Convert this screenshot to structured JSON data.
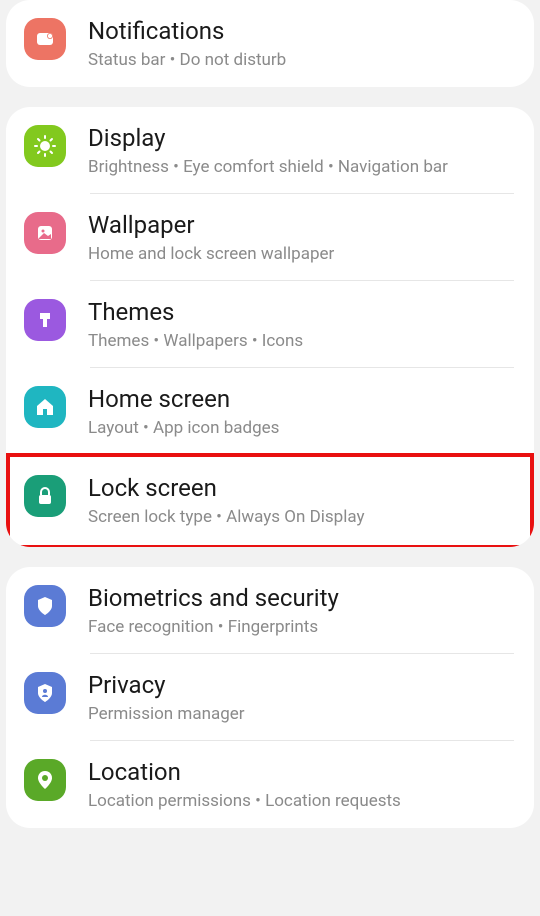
{
  "groups": [
    {
      "items": [
        {
          "id": "notifications",
          "title": "Notifications",
          "subtitle": "Status bar  •  Do not disturb",
          "color": "#ed7464",
          "icon": "bell",
          "highlight": false
        }
      ]
    },
    {
      "items": [
        {
          "id": "display",
          "title": "Display",
          "subtitle": "Brightness  •  Eye comfort shield  •  Navigation bar",
          "color": "#82c91e",
          "icon": "sun",
          "highlight": false
        },
        {
          "id": "wallpaper",
          "title": "Wallpaper",
          "subtitle": "Home and lock screen wallpaper",
          "color": "#e86b8a",
          "icon": "picture",
          "highlight": false
        },
        {
          "id": "themes",
          "title": "Themes",
          "subtitle": "Themes  •  Wallpapers  •  Icons",
          "color": "#9b59e0",
          "icon": "brush",
          "highlight": false
        },
        {
          "id": "homescreen",
          "title": "Home screen",
          "subtitle": "Layout  •  App icon badges",
          "color": "#1fb6c1",
          "icon": "home",
          "highlight": false
        },
        {
          "id": "lockscreen",
          "title": "Lock screen",
          "subtitle": "Screen lock type  •  Always On Display",
          "color": "#1a9e78",
          "icon": "lock",
          "highlight": true
        }
      ]
    },
    {
      "items": [
        {
          "id": "biometrics",
          "title": "Biometrics and security",
          "subtitle": "Face recognition  •  Fingerprints",
          "color": "#5b7bd5",
          "icon": "shield",
          "highlight": false
        },
        {
          "id": "privacy",
          "title": "Privacy",
          "subtitle": "Permission manager",
          "color": "#5b7bd5",
          "icon": "privacy",
          "highlight": false
        },
        {
          "id": "location",
          "title": "Location",
          "subtitle": "Location permissions  •  Location requests",
          "color": "#5aa928",
          "icon": "pin",
          "highlight": false
        }
      ]
    }
  ]
}
